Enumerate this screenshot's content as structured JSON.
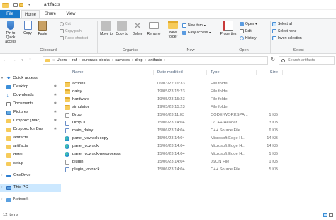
{
  "window": {
    "title": "artifacts"
  },
  "ribbon": {
    "tabs": [
      {
        "label": "File"
      },
      {
        "label": "Home"
      },
      {
        "label": "Share"
      },
      {
        "label": "View"
      }
    ],
    "clipboard": {
      "group_label": "Clipboard",
      "pin_label": "Pin to Quick access",
      "copy_label": "Copy",
      "paste_label": "Paste",
      "cut_label": "Cut",
      "copy_path_label": "Copy path",
      "paste_shortcut_label": "Paste shortcut"
    },
    "organise": {
      "group_label": "Organise",
      "move_to_label": "Move to",
      "copy_to_label": "Copy to",
      "delete_label": "Delete",
      "rename_label": "Rename"
    },
    "new": {
      "group_label": "New",
      "new_folder_label": "New folder",
      "new_item_label": "New item",
      "easy_access_label": "Easy access"
    },
    "open": {
      "group_label": "Open",
      "properties_label": "Properties",
      "open_label": "Open",
      "edit_label": "Edit",
      "history_label": "History"
    },
    "select": {
      "group_label": "Select",
      "select_all_label": "Select all",
      "select_none_label": "Select none",
      "invert_selection_label": "Invert selection"
    }
  },
  "address": {
    "crumbs": [
      "Users",
      "raf",
      "eurorack-blocks",
      "samples",
      "drop",
      "artifacts"
    ],
    "search_placeholder": "Search artifacts"
  },
  "nav": {
    "items": [
      {
        "label": "Quick access",
        "icon": "star-icon"
      },
      {
        "label": "Desktop",
        "icon": "desktop-icon",
        "pinned": true
      },
      {
        "label": "Downloads",
        "icon": "download-icon",
        "pinned": true
      },
      {
        "label": "Documents",
        "icon": "documents-icon",
        "pinned": true
      },
      {
        "label": "Pictures",
        "icon": "pictures-icon",
        "pinned": true
      },
      {
        "label": "Dropbox (Mac)",
        "icon": "folder-icon",
        "pinned": true
      },
      {
        "label": "Dropbox for Bus",
        "icon": "folder-icon",
        "pinned": true
      },
      {
        "label": "artifacts",
        "icon": "folder-icon"
      },
      {
        "label": "artifacts",
        "icon": "folder-icon"
      },
      {
        "label": "detail",
        "icon": "folder-icon"
      },
      {
        "label": "setup",
        "icon": "folder-icon"
      },
      {
        "label": "OneDrive",
        "icon": "cloud-icon"
      },
      {
        "label": "This PC",
        "icon": "computer-icon"
      },
      {
        "label": "Network",
        "icon": "network-icon"
      }
    ]
  },
  "files": {
    "headers": {
      "name": "Name",
      "date": "Date modified",
      "type": "Type",
      "size": "Size"
    },
    "rows": [
      {
        "name": "actions",
        "date": "06/03/22 16:33",
        "type": "File folder",
        "size": "",
        "icon": "folder"
      },
      {
        "name": "daisy",
        "date": "19/05/23 15:23",
        "type": "File folder",
        "size": "",
        "icon": "folder"
      },
      {
        "name": "hardware",
        "date": "19/05/23 15:23",
        "type": "File folder",
        "size": "",
        "icon": "folder"
      },
      {
        "name": "simulator",
        "date": "19/05/23 15:23",
        "type": "File folder",
        "size": "",
        "icon": "folder"
      },
      {
        "name": "Drop",
        "date": "15/06/23 11:03",
        "type": "CODE-WORKSPA...",
        "size": "1 KB",
        "icon": "file"
      },
      {
        "name": "DropUi",
        "date": "15/06/23 14:04",
        "type": "C/C++ Header",
        "size": "3 KB",
        "icon": "cfile"
      },
      {
        "name": "main_daisy",
        "date": "15/06/23 14:04",
        "type": "C++ Source File",
        "size": "6 KB",
        "icon": "cfile"
      },
      {
        "name": "panel_vcvrack copy",
        "date": "15/06/23 14:04",
        "type": "Microsoft Edge H...",
        "size": "14 KB",
        "icon": "edge"
      },
      {
        "name": "panel_vcvrack",
        "date": "15/06/23 14:04",
        "type": "Microsoft Edge H...",
        "size": "14 KB",
        "icon": "edge"
      },
      {
        "name": "panel_vcvrack-preprocess",
        "date": "15/06/23 14:04",
        "type": "Microsoft Edge H...",
        "size": "1 KB",
        "icon": "edge"
      },
      {
        "name": "plugin",
        "date": "15/06/23 14:04",
        "type": "JSON File",
        "size": "1 KB",
        "icon": "file"
      },
      {
        "name": "plugin_vcvrack",
        "date": "15/06/23 14:04",
        "type": "C++ Source File",
        "size": "5 KB",
        "icon": "cfile"
      }
    ]
  },
  "status": {
    "items_text": "12 items"
  },
  "colors": {
    "accent": "#1979ca",
    "selection": "#cce8ff",
    "folder": "#f6cb5a"
  }
}
